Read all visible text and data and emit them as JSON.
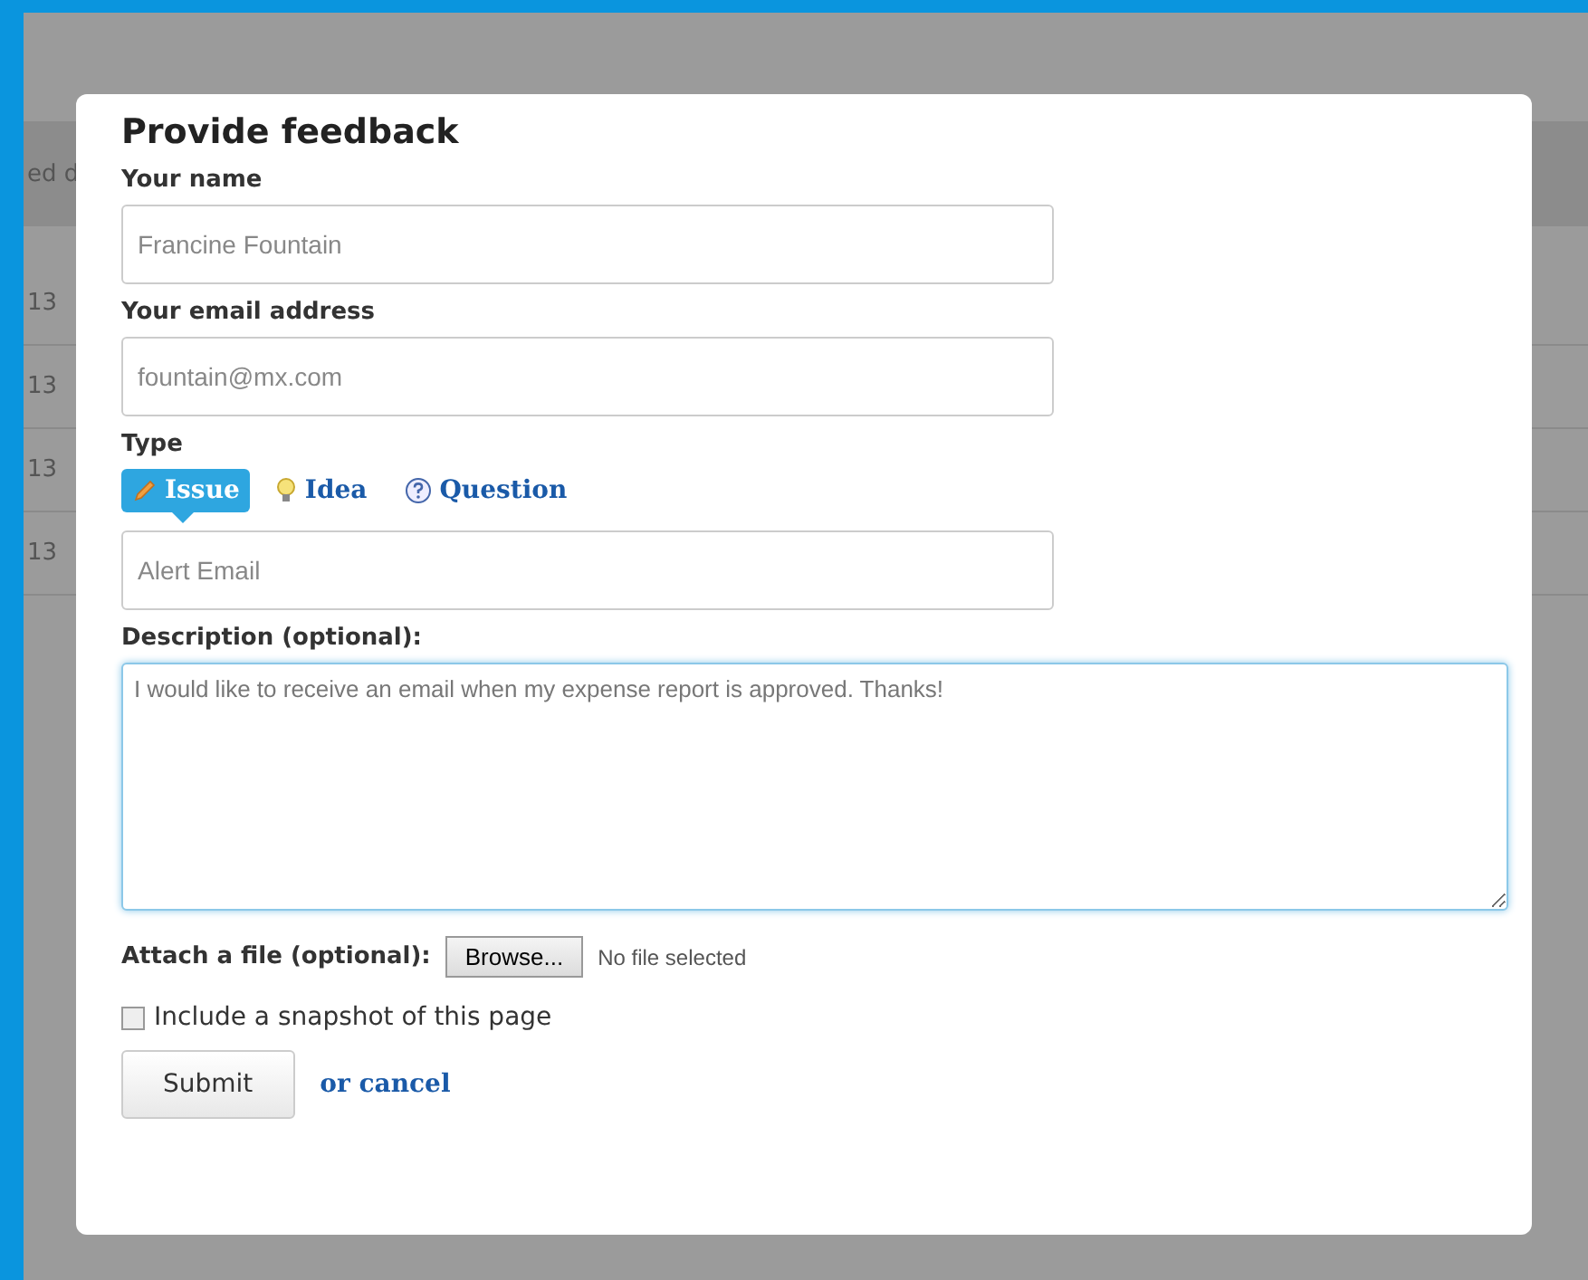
{
  "backdrop": {
    "header": "ed d",
    "cells": [
      "13",
      "13",
      "13",
      "13"
    ]
  },
  "dialog": {
    "title": "Provide feedback",
    "name_field": {
      "label": "Your name",
      "value": "Francine Fountain"
    },
    "email_field": {
      "label": "Your email address",
      "value": "fountain@mx.com"
    },
    "type": {
      "label": "Type",
      "options": [
        {
          "kind": "issue",
          "label": "Issue",
          "selected": true
        },
        {
          "kind": "idea",
          "label": "Idea",
          "selected": false
        },
        {
          "kind": "question",
          "label": "Question",
          "selected": false
        }
      ],
      "subject": "Alert Email"
    },
    "description": {
      "label": "Description (optional):",
      "value": "I would like to receive an email when my expense report is approved. Thanks!"
    },
    "attach": {
      "label": "Attach a file (optional):",
      "button": "Browse...",
      "status": "No file selected"
    },
    "snapshot": {
      "label": "Include a snapshot of this page",
      "checked": false
    },
    "submit": "Submit",
    "cancel": "or cancel"
  }
}
